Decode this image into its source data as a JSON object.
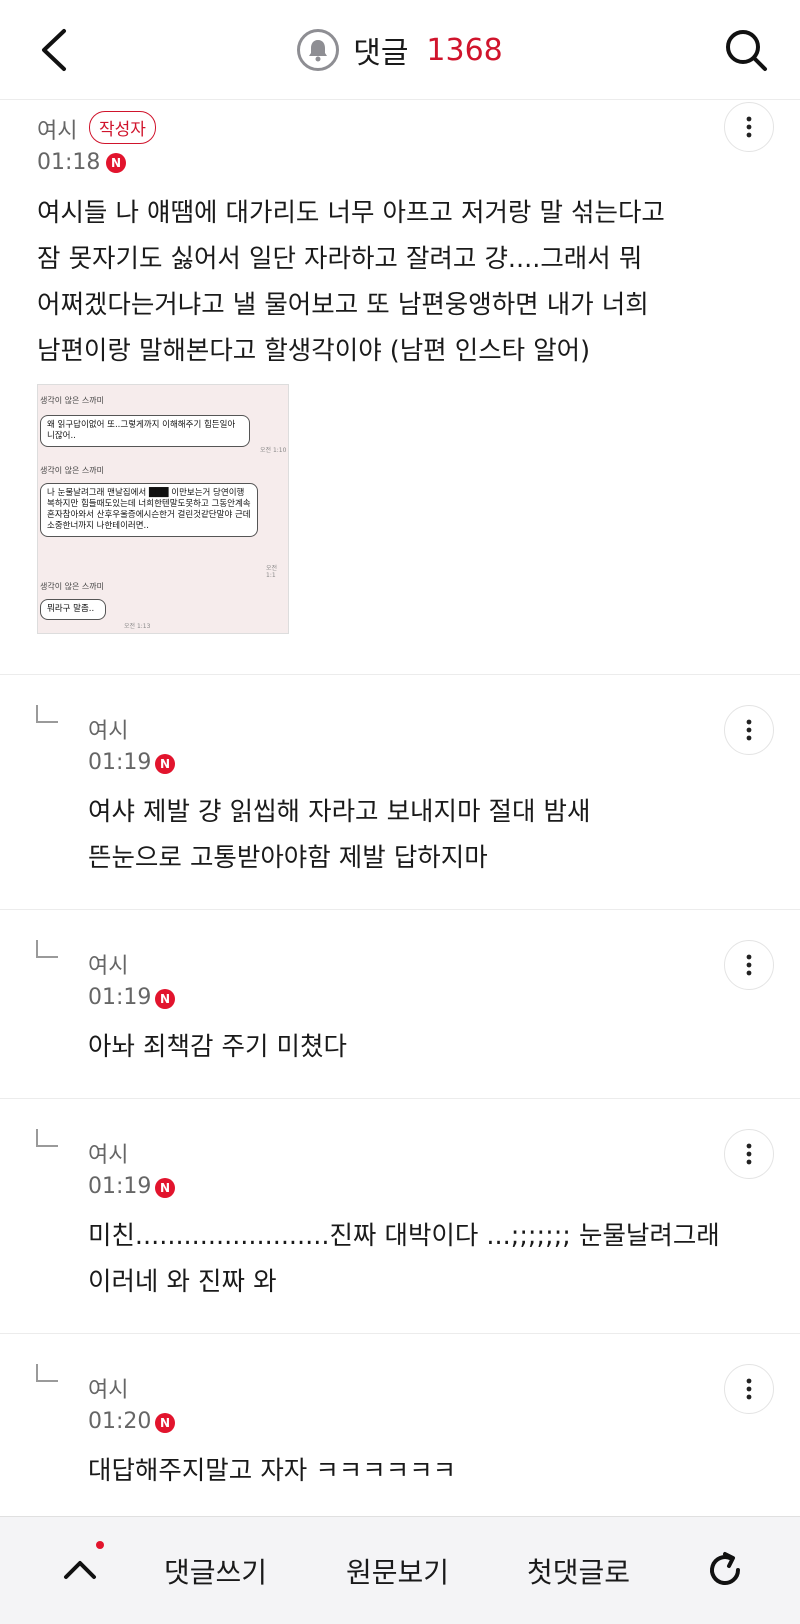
{
  "header": {
    "title": "댓글",
    "count": "1368",
    "count_color": "#d0142c",
    "back_icon": "chevron-left-icon",
    "search_icon": "search-icon",
    "bell_icon": "bell-icon"
  },
  "comments": [
    {
      "nick": "여시",
      "author_badge": "작성자",
      "time": "01:18",
      "new_badge": "N",
      "lines": [
        "여시들 나 얘땜에 대가리도 너무 아프고 저거랑 말 섞는다고",
        "잠 못자기도 싫어서 일단 자라하고 잘려고 걍....그래서 뭐",
        "어쩌겠다는거냐고 낼 물어보고 또 남편웅앵하면 내가 너희",
        "남편이랑 말해본다고 할생각이야 (남편 인스타 알어)"
      ],
      "attachment": {
        "sender1": "생각이 않은 스까미",
        "msg1": "왜 읽구답이없어 또..그렇게까지 이해해주기 힘든일아니잖어..",
        "time1": "오전 1:10",
        "sender2": "생각이 않은 스까미",
        "msg2": "나 눈물날려그래 맨날집에서 ███ 이만보는거 당연이행복하지만 힘들때도있는데 너희한텐말도못하고 그동안계속 혼자참아와서 산후우울증에시슨한거 걸린것같단말야 근데소중한너까지 나한테이러면..",
        "time2": "오전 1:1",
        "sender3": "생각이 않은 스까미",
        "msg3": "뭐라구 말좀..",
        "time3": "오전 1:13"
      }
    },
    {
      "nick": "여시",
      "time": "01:19",
      "new_badge": "N",
      "lines": [
        "여샤 제발 걍 읽씹해 자라고 보내지마 절대 밤새",
        "뜬눈으로 고통받아야함 제발 답하지마"
      ]
    },
    {
      "nick": "여시",
      "time": "01:19",
      "new_badge": "N",
      "lines": [
        "아놔 죄책감 주기 미쳤다"
      ]
    },
    {
      "nick": "여시",
      "time": "01:19",
      "new_badge": "N",
      "lines": [
        "미친........................진짜 대박이다 ...;;;;;;; 눈물날려그래",
        "이러네 와 진짜 와"
      ]
    },
    {
      "nick": "여시",
      "time": "01:20",
      "new_badge": "N",
      "lines": [
        "대답해주지말고 자자 ㅋㅋㅋㅋㅋㅋ"
      ]
    }
  ],
  "bottom_bar": {
    "up_icon": "chevron-up-icon",
    "write": "댓글쓰기",
    "original": "원문보기",
    "first": "첫댓글로",
    "refresh_icon": "refresh-icon"
  }
}
